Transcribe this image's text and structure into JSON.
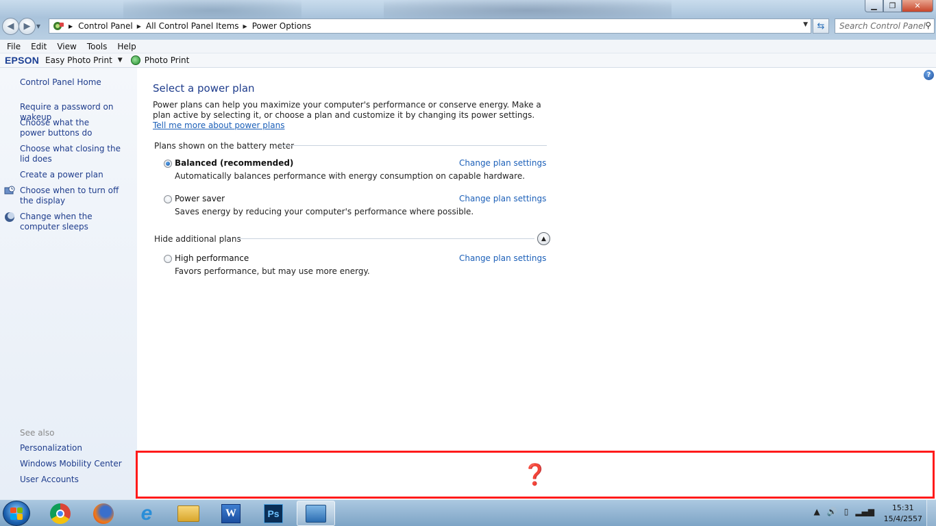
{
  "window": {
    "minimize_glyph": "▁",
    "maximize_glyph": "❐",
    "close_glyph": "✕"
  },
  "address": {
    "crumbs": [
      "Control Panel",
      "All Control Panel Items",
      "Power Options"
    ],
    "search_placeholder": "Search Control Panel"
  },
  "menu": [
    "File",
    "Edit",
    "View",
    "Tools",
    "Help"
  ],
  "epson_toolbar": {
    "logo": "EPSON",
    "easy_photo_print": "Easy Photo Print",
    "photo_print": "Photo Print"
  },
  "sidebar": {
    "home": "Control Panel Home",
    "items": [
      "Require a password on wakeup",
      "Choose what the power buttons do",
      "Choose what closing the lid does",
      "Create a power plan",
      "Choose when to turn off the display",
      "Change when the computer sleeps"
    ],
    "see_also_label": "See also",
    "see_also": [
      "Personalization",
      "Windows Mobility Center",
      "User Accounts"
    ]
  },
  "main": {
    "title": "Select a power plan",
    "intro": "Power plans can help you maximize your computer's performance or conserve energy. Make a plan active by selecting it, or choose a plan and customize it by changing its power settings. ",
    "intro_link": "Tell me more about power plans",
    "battery_group_label": "Plans shown on the battery meter",
    "additional_group_label": "Hide additional plans",
    "change_settings_label": "Change plan settings",
    "plans": [
      {
        "name": "Balanced (recommended)",
        "desc": "Automatically balances performance with energy consumption on capable hardware.",
        "selected": true
      },
      {
        "name": "Power saver",
        "desc": "Saves energy by reducing your computer's performance where possible.",
        "selected": false
      },
      {
        "name": "High performance",
        "desc": "Favors performance, but may use more energy.",
        "selected": false
      }
    ]
  },
  "redaction": {
    "symbol": "❓"
  },
  "taskbar": {
    "apps": [
      "chrome",
      "firefox",
      "internet-explorer",
      "windows-explorer",
      "word",
      "photoshop",
      "control-panel"
    ],
    "word_label": "W",
    "ps_label": "Ps",
    "clock_time": "15:31",
    "clock_date": "15/4/2557"
  },
  "colors": {
    "link": "#1e3c8c",
    "accent_red": "#ff1a1a"
  }
}
